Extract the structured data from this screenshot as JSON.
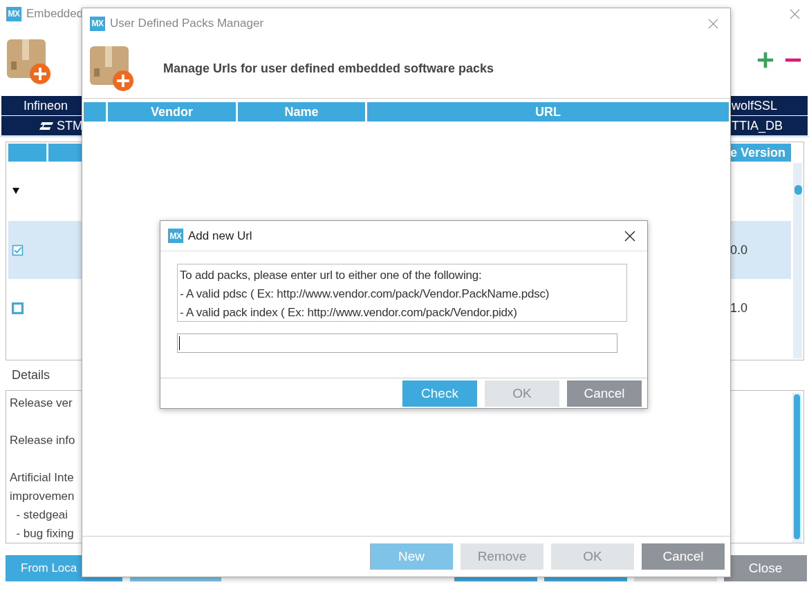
{
  "background_window": {
    "logo": "MX",
    "title": "Embedded",
    "vendor_rows": [
      {
        "left": "Infineon",
        "right": "wolfSSL",
        "st_logo": false
      },
      {
        "left": "STM",
        "right": "TTIA_DB",
        "st_logo": true
      }
    ],
    "table": {
      "header": "e Version",
      "rows": [
        {
          "kind": "group",
          "expanded": true
        },
        {
          "kind": "pack",
          "checked": true,
          "selected": true,
          "version": "0.0"
        },
        {
          "kind": "pack",
          "checked": false,
          "selected": false,
          "version": "1.0"
        }
      ]
    },
    "details": {
      "label": "Details",
      "paragraphs": [
        [
          "Release ver"
        ],
        [
          "Release info"
        ],
        [
          "Artificial Inte",
          "improvemen",
          "  - stedgeai",
          "  - bug fixing"
        ]
      ]
    },
    "buttons": [
      {
        "label": "From Loca",
        "kind": "primary"
      },
      {
        "kind": "light"
      },
      {
        "kind": "primary"
      },
      {
        "kind": "primary"
      },
      {
        "kind": "disabled"
      },
      {
        "label": "Close",
        "kind": "neutral"
      }
    ]
  },
  "packs_dialog": {
    "logo": "MX",
    "title": "User Defined Packs Manager",
    "heading": "Manage Urls for user defined embedded software packs",
    "columns": [
      "Vendor",
      "Name",
      "URL"
    ],
    "buttons": [
      {
        "label": "New",
        "kind": "light"
      },
      {
        "label": "Remove",
        "kind": "disabled"
      },
      {
        "label": "OK",
        "kind": "disabled"
      },
      {
        "label": "Cancel",
        "kind": "neutral"
      }
    ]
  },
  "url_dialog": {
    "logo": "MX",
    "title": "Add new Url",
    "info_lines": [
      "To add packs, please enter url to either one of the following:",
      "- A valid pdsc ( Ex: http://www.vendor.com/pack/Vendor.PackName.pdsc)",
      "- A valid pack index ( Ex: http://www.vendor.com/pack/Vendor.pidx)"
    ],
    "buttons": [
      {
        "label": "Check",
        "kind": "primary"
      },
      {
        "label": "OK",
        "kind": "disabled"
      },
      {
        "label": "Cancel",
        "kind": "neutral"
      }
    ]
  }
}
